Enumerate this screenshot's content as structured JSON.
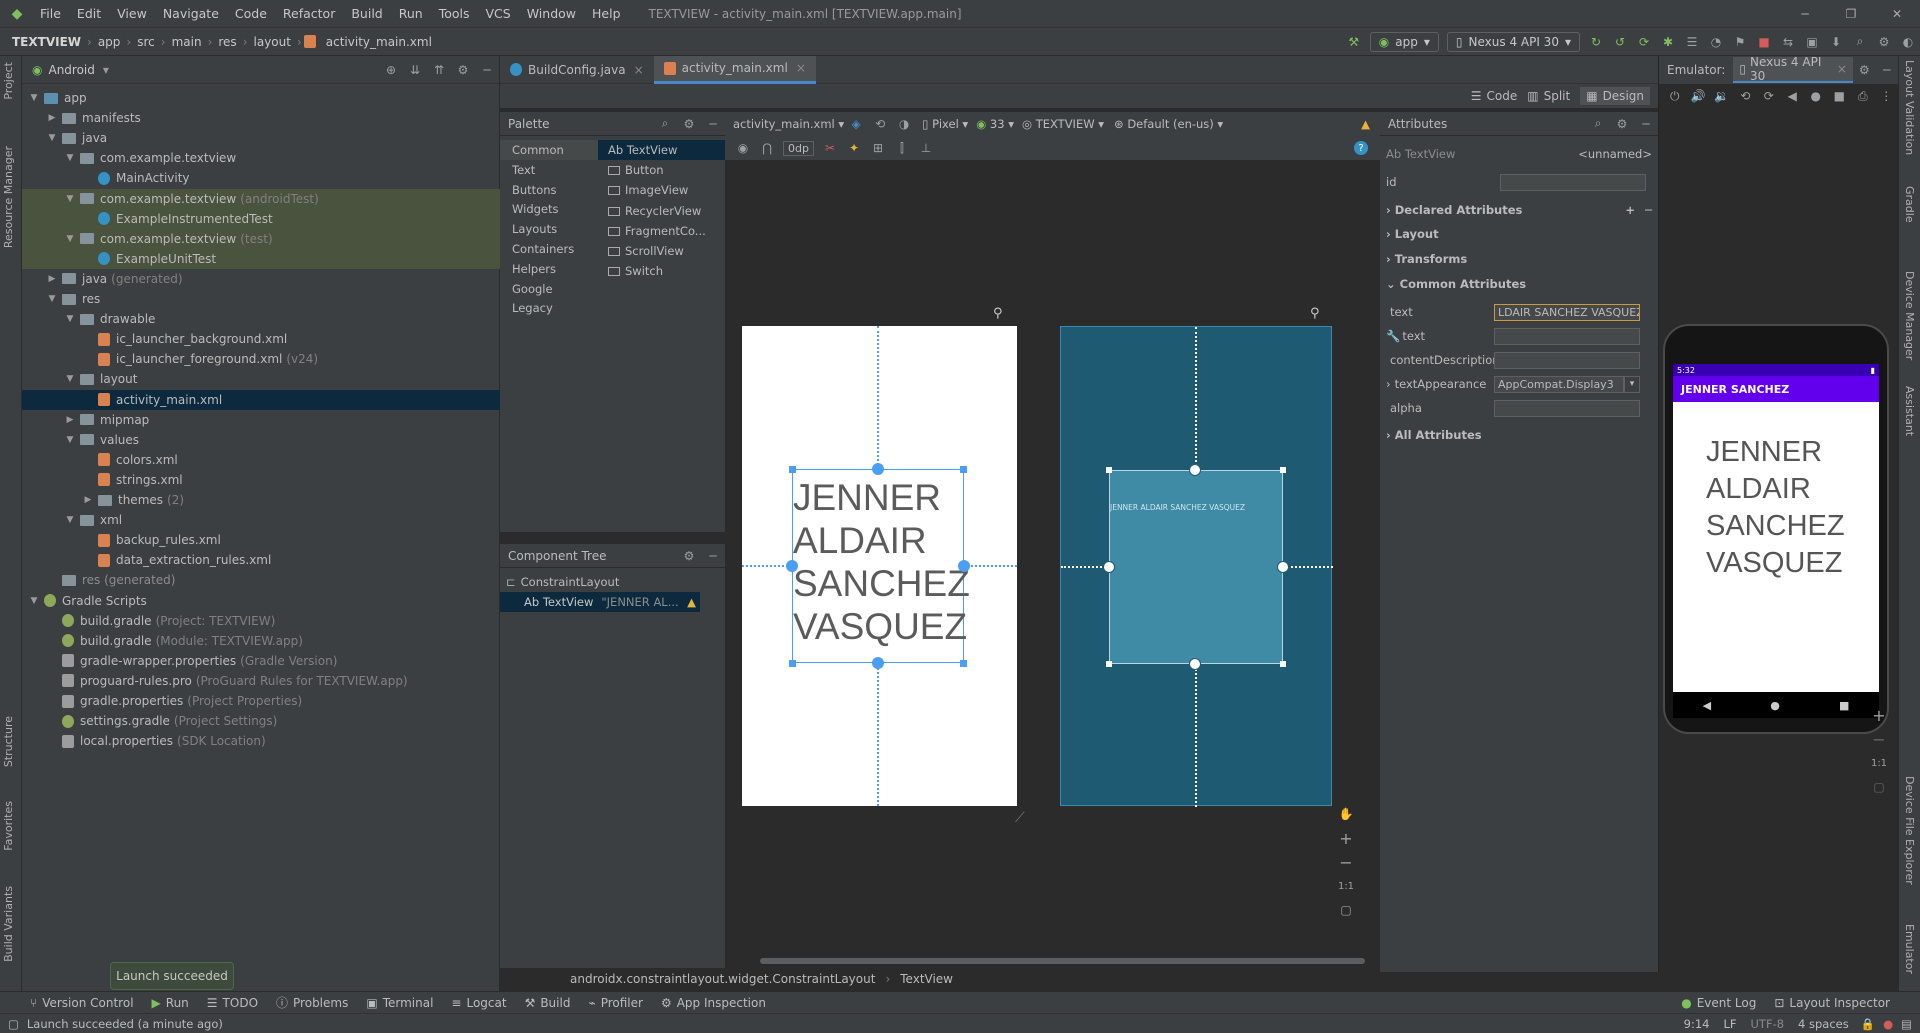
{
  "menu": {
    "items": [
      "File",
      "Edit",
      "View",
      "Navigate",
      "Code",
      "Refactor",
      "Build",
      "Run",
      "Tools",
      "VCS",
      "Window",
      "Help"
    ],
    "title": "TEXTVIEW - activity_main.xml [TEXTVIEW.app.main]"
  },
  "breadcrumb": [
    "TEXTVIEW",
    "app",
    "src",
    "main",
    "res",
    "layout",
    "activity_main.xml"
  ],
  "toolbar": {
    "run_config": "app",
    "device": "Nexus 4 API 30"
  },
  "project": {
    "view_mode": "Android",
    "tree": [
      {
        "label": "app",
        "indent": 0,
        "arrow": "down",
        "icon": "folder-blue"
      },
      {
        "label": "manifests",
        "indent": 1,
        "arrow": "right",
        "icon": "folder"
      },
      {
        "label": "java",
        "indent": 1,
        "arrow": "down",
        "icon": "folder"
      },
      {
        "label": "com.example.textview",
        "indent": 2,
        "arrow": "down",
        "icon": "folder"
      },
      {
        "label": "MainActivity",
        "indent": 3,
        "arrow": "",
        "icon": "class"
      },
      {
        "label": "com.example.textview",
        "gray": "(androidTest)",
        "indent": 2,
        "arrow": "down",
        "icon": "folder",
        "test": true
      },
      {
        "label": "ExampleInstrumentedTest",
        "indent": 3,
        "arrow": "",
        "icon": "class",
        "test": true
      },
      {
        "label": "com.example.textview",
        "gray": "(test)",
        "indent": 2,
        "arrow": "down",
        "icon": "folder",
        "test": true
      },
      {
        "label": "ExampleUnitTest",
        "indent": 3,
        "arrow": "",
        "icon": "class",
        "test": true
      },
      {
        "label": "java",
        "gray": "(generated)",
        "indent": 1,
        "arrow": "right",
        "icon": "folder"
      },
      {
        "label": "res",
        "indent": 1,
        "arrow": "down",
        "icon": "folder"
      },
      {
        "label": "drawable",
        "indent": 2,
        "arrow": "down",
        "icon": "folder"
      },
      {
        "label": "ic_launcher_background.xml",
        "indent": 3,
        "arrow": "",
        "icon": "xml"
      },
      {
        "label": "ic_launcher_foreground.xml",
        "gray": "(v24)",
        "indent": 3,
        "arrow": "",
        "icon": "xml"
      },
      {
        "label": "layout",
        "indent": 2,
        "arrow": "down",
        "icon": "folder"
      },
      {
        "label": "activity_main.xml",
        "indent": 3,
        "arrow": "",
        "icon": "xml",
        "selected": true
      },
      {
        "label": "mipmap",
        "indent": 2,
        "arrow": "right",
        "icon": "folder"
      },
      {
        "label": "values",
        "indent": 2,
        "arrow": "down",
        "icon": "folder"
      },
      {
        "label": "colors.xml",
        "indent": 3,
        "arrow": "",
        "icon": "xml"
      },
      {
        "label": "strings.xml",
        "indent": 3,
        "arrow": "",
        "icon": "xml"
      },
      {
        "label": "themes",
        "gray": "(2)",
        "indent": 3,
        "arrow": "right",
        "icon": "folder",
        "themes": true
      },
      {
        "label": "xml",
        "indent": 2,
        "arrow": "down",
        "icon": "folder"
      },
      {
        "label": "backup_rules.xml",
        "indent": 3,
        "arrow": "",
        "icon": "xml"
      },
      {
        "label": "data_extraction_rules.xml",
        "indent": 3,
        "arrow": "",
        "icon": "xml"
      },
      {
        "label": "res (generated)",
        "indent": 1,
        "arrow": "",
        "icon": "folder",
        "dim": true
      },
      {
        "label": "Gradle Scripts",
        "indent": 0,
        "arrow": "down",
        "icon": "gradle"
      },
      {
        "label": "build.gradle",
        "gray": "(Project: TEXTVIEW)",
        "indent": 1,
        "arrow": "",
        "icon": "gradle"
      },
      {
        "label": "build.gradle",
        "gray": "(Module: TEXTVIEW.app)",
        "indent": 1,
        "arrow": "",
        "icon": "gradle"
      },
      {
        "label": "gradle-wrapper.properties",
        "gray": "(Gradle Version)",
        "indent": 1,
        "arrow": "",
        "icon": "prop"
      },
      {
        "label": "proguard-rules.pro",
        "gray": "(ProGuard Rules for TEXTVIEW.app)",
        "indent": 1,
        "arrow": "",
        "icon": "prop"
      },
      {
        "label": "gradle.properties",
        "gray": "(Project Properties)",
        "indent": 1,
        "arrow": "",
        "icon": "prop"
      },
      {
        "label": "settings.gradle",
        "gray": "(Project Settings)",
        "indent": 1,
        "arrow": "",
        "icon": "gradle"
      },
      {
        "label": "local.properties",
        "gray": "(SDK Location)",
        "indent": 1,
        "arrow": "",
        "icon": "prop"
      }
    ]
  },
  "left_stripe": {
    "project": "Project",
    "resource_manager": "Resource Manager",
    "structure": "Structure",
    "favorites": "Favorites",
    "build_variants": "Build Variants"
  },
  "right_stripe": {
    "layout_validation": "Layout Validation",
    "gradle": "Gradle",
    "device_manager": "Device Manager",
    "assistant": "Assistant",
    "device_file_explorer": "Device File Explorer",
    "emulator": "Emulator"
  },
  "editor_tabs": [
    {
      "label": "BuildConfig.java",
      "active": false
    },
    {
      "label": "activity_main.xml",
      "active": true
    }
  ],
  "modes": {
    "code": "Code",
    "split": "Split",
    "design": "Design"
  },
  "palette": {
    "title": "Palette",
    "categories": [
      "Common",
      "Text",
      "Buttons",
      "Widgets",
      "Layouts",
      "Containers",
      "Helpers",
      "Google",
      "Legacy"
    ],
    "items": [
      "Ab TextView",
      "Button",
      "ImageView",
      "RecyclerView",
      "FragmentCo...",
      "ScrollView",
      "Switch"
    ]
  },
  "component_tree": {
    "title": "Component Tree",
    "root": "ConstraintLayout",
    "child": "Ab TextView",
    "child_text": "\"JENNER AL..."
  },
  "design_toolbar": {
    "file": "activity_main.xml",
    "device": "Pixel",
    "api": "33",
    "theme": "TEXTVIEW",
    "locale": "Default (en-us)",
    "margin": "0dp"
  },
  "canvas": {
    "text_lines": [
      "JENNER",
      "ALDAIR",
      "SANCHEZ",
      "VASQUEZ"
    ],
    "blueprint_text": "JENNER ALDAIR SANCHEZ VASQUEZ",
    "zoom_fit": "1:1"
  },
  "attributes": {
    "title": "Attributes",
    "widget": "Ab TextView",
    "unnamed": "<unnamed>",
    "id_label": "id",
    "declared": "Declared Attributes",
    "layout": "Layout",
    "transforms": "Transforms",
    "common": "Common Attributes",
    "text_label": "text",
    "text_value": "LDAIR SANCHEZ VASQUEZ",
    "tools_text_label": "text",
    "content_desc_label": "contentDescription",
    "text_appearance_label": "textAppearance",
    "text_appearance_value": "AppCompat.Display3",
    "alpha_label": "alpha",
    "all": "All Attributes"
  },
  "emulator": {
    "label": "Emulator:",
    "device_tab": "Nexus 4 API 30",
    "time": "5:32",
    "app_title": "JENNER SANCHEZ",
    "text_lines": [
      "JENNER",
      "ALDAIR",
      "SANCHEZ",
      "VASQUEZ"
    ],
    "zoom": "1:1"
  },
  "footer_breadcrumb": [
    "androidx.constraintlayout.widget.ConstraintLayout",
    "TextView"
  ],
  "bottom_tabs": [
    "Version Control",
    "Run",
    "TODO",
    "Problems",
    "Terminal",
    "Logcat",
    "Build",
    "Profiler",
    "App Inspection"
  ],
  "bottom_right_tabs": [
    "Event Log",
    "Layout Inspector"
  ],
  "toast": "Launch succeeded",
  "status": {
    "message": "Launch succeeded (a minute ago)",
    "position": "9:14",
    "line_sep": "LF",
    "encoding": "UTF-8",
    "indent": "4 spaces"
  },
  "colors": {
    "accent": "#4a88c7",
    "emu_appbar": "#6200ee",
    "emu_statusbar": "#3700b3",
    "blueprint": "#1e5a72"
  }
}
